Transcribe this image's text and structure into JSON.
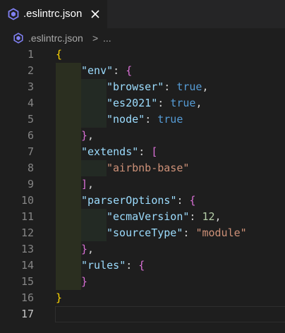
{
  "tab": {
    "title": ".eslintrc.json",
    "icon": "eslint-icon",
    "close_icon": "close-icon"
  },
  "breadcrumb": {
    "file": ".eslintrc.json",
    "separator": ">",
    "more": "..."
  },
  "editor": {
    "active_line": 17,
    "lines": [
      {
        "num": "1"
      },
      {
        "num": "2"
      },
      {
        "num": "3"
      },
      {
        "num": "4"
      },
      {
        "num": "5"
      },
      {
        "num": "6"
      },
      {
        "num": "7"
      },
      {
        "num": "8"
      },
      {
        "num": "9"
      },
      {
        "num": "10"
      },
      {
        "num": "11"
      },
      {
        "num": "12"
      },
      {
        "num": "13"
      },
      {
        "num": "14"
      },
      {
        "num": "15"
      },
      {
        "num": "16"
      },
      {
        "num": "17"
      }
    ],
    "tokens": {
      "open_brace": "{",
      "close_brace": "}",
      "open_bracket": "[",
      "close_bracket": "]",
      "quote": "\"",
      "colon": ": ",
      "comma": ",",
      "env": "env",
      "browser": "browser",
      "es2021": "es2021",
      "node": "node",
      "true": "true",
      "extends": "extends",
      "airbnb": "\"airbnb-base\"",
      "parserOptions": "parserOptions",
      "ecmaVersion": "ecmaVersion",
      "twelve": "12",
      "sourceType": "sourceType",
      "module": "\"module\"",
      "rules": "rules"
    }
  },
  "colors": {
    "background": "#1e1e1e",
    "tabbar": "#252526",
    "key": "#9cdcfe",
    "string": "#ce9178",
    "keyword": "#569cd6",
    "number": "#b5cea8",
    "bracket_level1": "#ffd700",
    "bracket_level2": "#da70d6",
    "bracket_level3": "#179fff",
    "line_number": "#858585"
  }
}
